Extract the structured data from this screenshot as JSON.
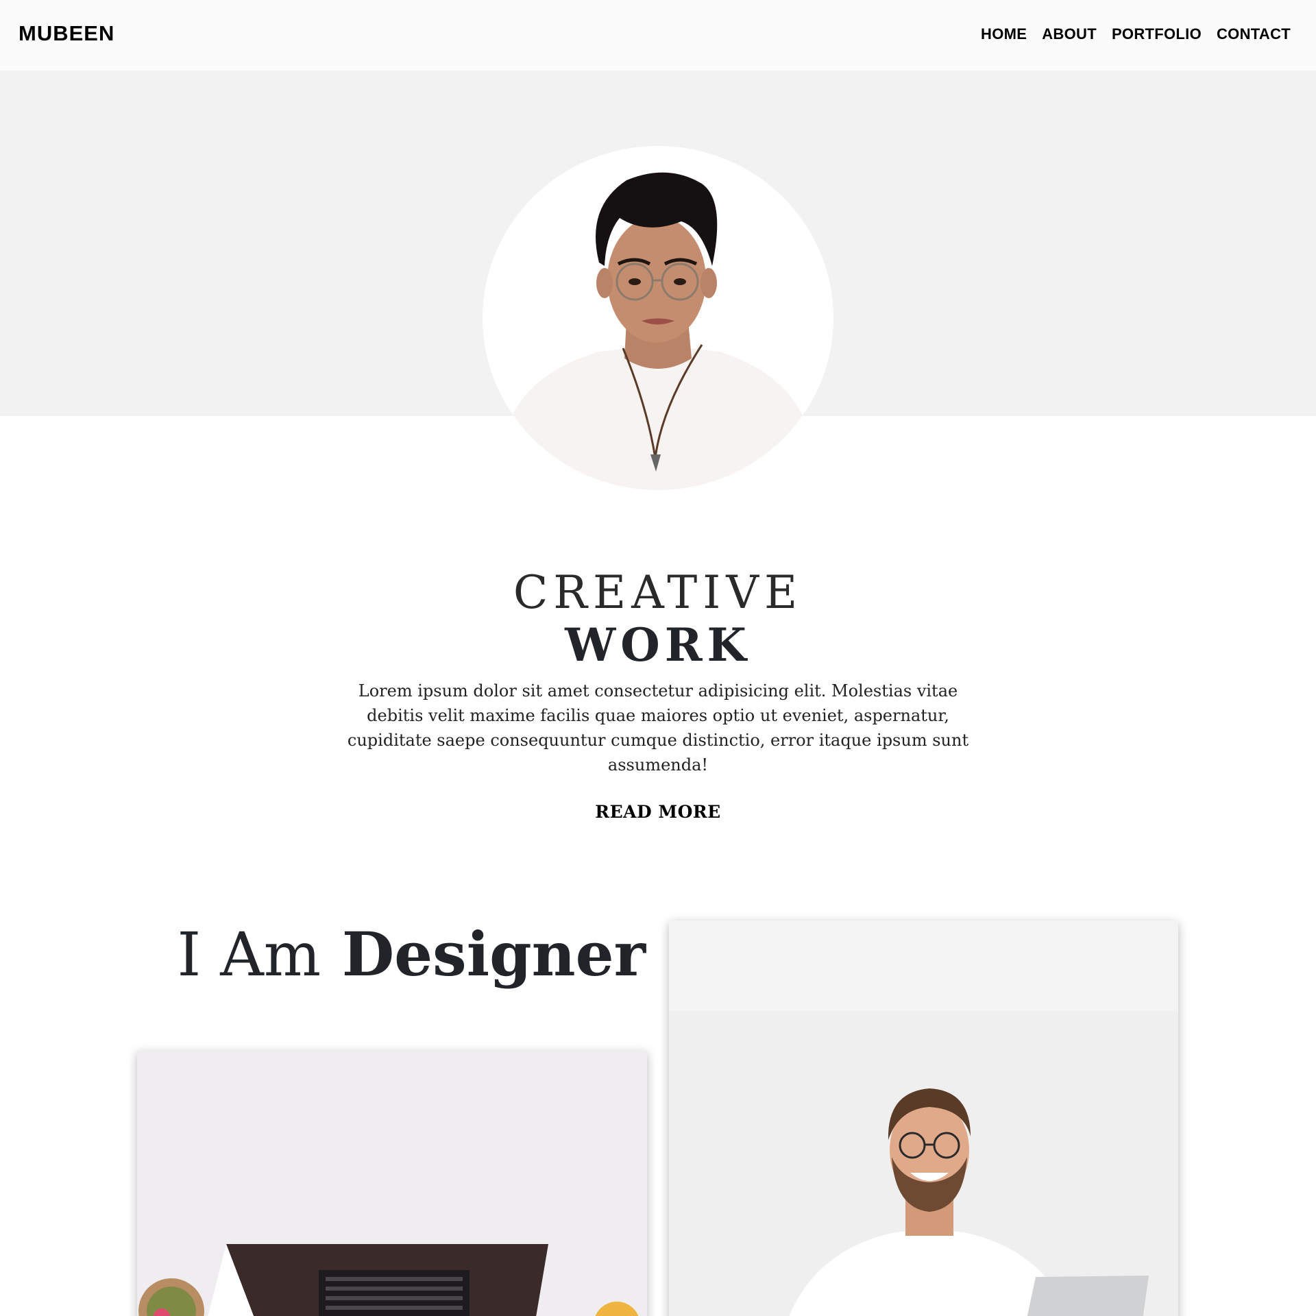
{
  "navbar": {
    "brand": "MUBEEN",
    "links": [
      "HOME",
      "ABOUT",
      "PORTFOLIO",
      "CONTACT"
    ]
  },
  "hero": {
    "title_light": "CREATIVE",
    "title_bold": "WORK",
    "description": "Lorem ipsum dolor sit amet consectetur adipisicing elit. Molestias vitae debitis velit maxime facilis quae maiores optio ut eveniet, aspernatur, cupiditate saepe consequuntur cumque distinctio, error itaque ipsum sunt assumenda!",
    "button_label": "READ MORE"
  },
  "designer": {
    "heading_light": "I Am",
    "heading_bold": "Designer"
  },
  "colors": {
    "navbar_bg": "#fbfbfb",
    "hero_band_bg": "#f2f2f2",
    "text": "#212529"
  }
}
